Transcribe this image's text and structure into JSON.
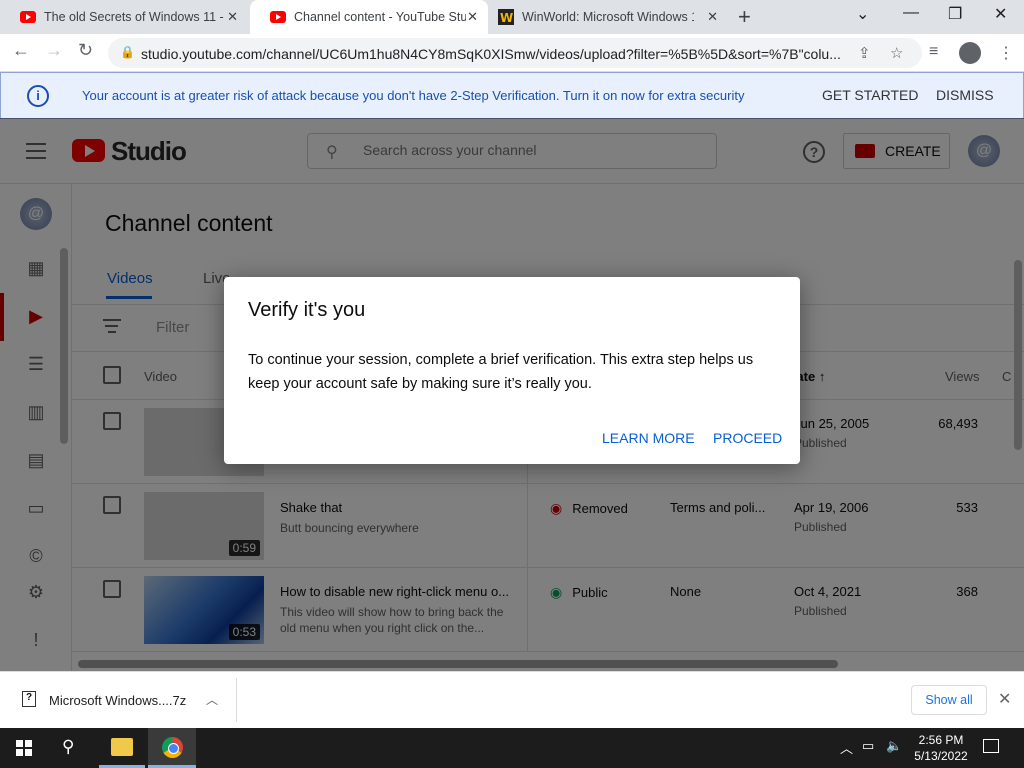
{
  "browser": {
    "tabs": [
      {
        "title": "The old Secrets of Windows 11 - ",
        "active": false
      },
      {
        "title": "Channel content - YouTube Studio",
        "active": true
      },
      {
        "title": "WinWorld: Microsoft Windows 1",
        "active": false
      }
    ],
    "url": "studio.youtube.com/channel/UC6Um1hu8N4CY8mSqK0XISmw/videos/upload?filter=%5B%5D&sort=%7B\"colu..."
  },
  "banner": {
    "message": "Your account is at greater risk of attack because you don't have 2-Step Verification. Turn it on now for extra security",
    "get_started": "GET STARTED",
    "dismiss": "DISMISS"
  },
  "header": {
    "logo_text": "Studio",
    "search_placeholder": "Search across your channel",
    "create_label": "CREATE"
  },
  "content": {
    "title": "Channel content",
    "tabs": [
      "Videos",
      "Live"
    ],
    "filter_label": "Filter",
    "columns": {
      "video": "Video",
      "date": "Date",
      "views": "Views",
      "extra": "C"
    },
    "rows": [
      {
        "title": "",
        "description": "",
        "duration": "",
        "visibility": "",
        "restrictions": "",
        "date": "Jun 25, 2005",
        "date_status": "Published",
        "views": "68,493"
      },
      {
        "title": "Shake that",
        "description": "Butt bouncing everywhere",
        "duration": "0:59",
        "visibility": "Removed",
        "restrictions": "Terms and poli...",
        "date": "Apr 19, 2006",
        "date_status": "Published",
        "views": "533"
      },
      {
        "title": "How to disable new right-click menu o...",
        "description": "This video will show how to bring back the old menu when you right click on the...",
        "duration": "0:53",
        "visibility": "Public",
        "restrictions": "None",
        "date": "Oct 4, 2021",
        "date_status": "Published",
        "views": "368"
      }
    ]
  },
  "dialog": {
    "title": "Verify it's you",
    "body": "To continue your session, complete a brief verification. This extra step helps us keep your account safe by making sure it’s really you.",
    "learn_more": "LEARN MORE",
    "proceed": "PROCEED"
  },
  "downloads": {
    "file_name": "Microsoft Windows....7z",
    "show_all": "Show all"
  },
  "taskbar": {
    "time": "2:56 PM",
    "date": "5/13/2022"
  },
  "colors": {
    "accent": "#065fd4",
    "youtube_red": "#ff0000",
    "removed": "#cc0000",
    "public": "#0f9d58"
  }
}
